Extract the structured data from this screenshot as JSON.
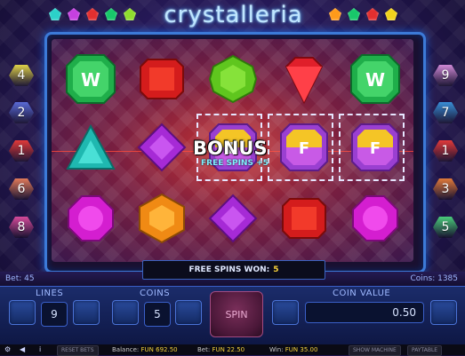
{
  "game": {
    "title": "crystalleria"
  },
  "header_gems": {
    "left": [
      "#2bd1c9",
      "#c640e0",
      "#e32f2f",
      "#18c86a",
      "#8fdc2e"
    ],
    "right": [
      "#ff9a1a",
      "#18c86a",
      "#e32f2f",
      "#f2d21c"
    ]
  },
  "side_lines": {
    "left": [
      {
        "num": "4",
        "color": "#e0d24a"
      },
      {
        "num": "2",
        "color": "#5a6bd6"
      },
      {
        "num": "1",
        "color": "#e23a3a"
      },
      {
        "num": "6",
        "color": "#e07a5a"
      },
      {
        "num": "8",
        "color": "#d54a9a"
      }
    ],
    "right": [
      {
        "num": "9",
        "color": "#d08ad6"
      },
      {
        "num": "7",
        "color": "#3a8fd6"
      },
      {
        "num": "1",
        "color": "#e23a3a"
      },
      {
        "num": "3",
        "color": "#e07a3a"
      },
      {
        "num": "5",
        "color": "#4acb7a"
      }
    ]
  },
  "reels": {
    "symbols": [
      {
        "name": "wild-symbol",
        "label": "W"
      },
      {
        "name": "red-square-gem"
      },
      {
        "name": "green-octagon-gem"
      },
      {
        "name": "red-diamond-gem"
      },
      {
        "name": "wild-symbol",
        "label": "W"
      },
      {
        "name": "teal-triangle-gem"
      },
      {
        "name": "purple-diamond-gem"
      },
      {
        "name": "free-spin-symbol",
        "label": "F"
      },
      {
        "name": "free-spin-symbol",
        "label": "F"
      },
      {
        "name": "free-spin-symbol",
        "label": "F"
      },
      {
        "name": "magenta-round-gem"
      },
      {
        "name": "orange-hexagon-gem"
      },
      {
        "name": "purple-diamond-gem"
      },
      {
        "name": "red-square-gem"
      },
      {
        "name": "magenta-round-gem"
      }
    ]
  },
  "bonus": {
    "title": "BONUS",
    "subtitle": "FREE SPINS +5"
  },
  "free_spins": {
    "label": "FREE SPINS WON:",
    "value": "5"
  },
  "info": {
    "bet": "Bet: 45",
    "coins": "Coins: 1385"
  },
  "controls": {
    "lines_label": "LINES",
    "lines_value": "9",
    "coins_label": "COINS",
    "coins_value": "5",
    "spin_label": "SPIN",
    "coin_value_label": "COIN VALUE",
    "coin_value": "0.50"
  },
  "status": {
    "reset_bets": "RESET BETS",
    "balance_label": "Balance:",
    "balance_value": "FUN 692.50",
    "bet_label": "Bet:",
    "bet_value": "FUN 22.50",
    "win_label": "Win:",
    "win_value": "FUN 35.00",
    "show_machine": "SHOW MACHINE",
    "paytable": "PAYTABLE"
  }
}
